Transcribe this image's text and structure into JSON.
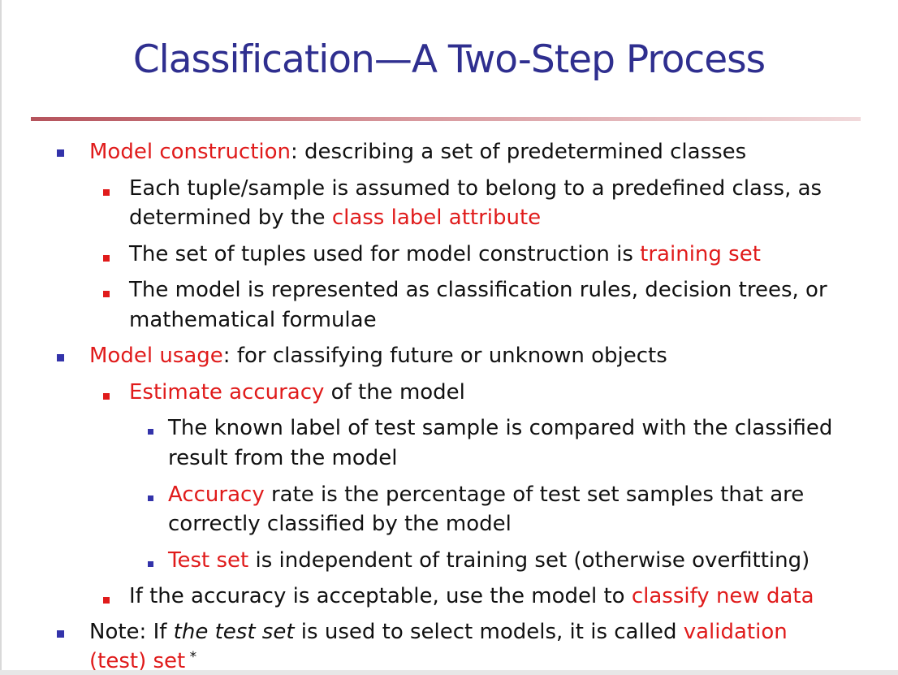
{
  "title": "Classification—A Two-Step Process",
  "colors": {
    "title": "#2f2f8f",
    "highlight": "#e01b1b",
    "level1_bullet": "#3333aa",
    "level2_bullet": "#e01b1b",
    "level3_bullet": "#3333aa",
    "divider": "#b5535c"
  },
  "bullets": {
    "b1": {
      "term": "Model construction",
      "rest": ": describing a set of predetermined classes"
    },
    "b1_1": {
      "l1": "Each tuple/sample is assumed to belong to a predefined class, as",
      "l2_pre": "determined by the ",
      "l2_term": "class label attribute"
    },
    "b1_2": {
      "pre": "The set of tuples used for model construction is ",
      "term": "training set"
    },
    "b1_3": {
      "l1": "The model is represented as classification rules, decision trees, or",
      "l2": "mathematical formulae"
    },
    "b2": {
      "term": "Model usage",
      "rest": ": for classifying future or unknown objects"
    },
    "b2_1": {
      "term": "Estimate accuracy",
      "rest": " of the model"
    },
    "b2_1_1": {
      "l1": "The known label of test sample is compared with the classified",
      "l2": "result from the model"
    },
    "b2_1_2": {
      "term": "Accuracy",
      "l1_rest": " rate is the percentage of test set samples that are",
      "l2": "correctly classified by the model"
    },
    "b2_1_3": {
      "term": "Test set",
      "rest": " is independent of training set (otherwise overfitting)"
    },
    "b2_2": {
      "pre": "If the accuracy is acceptable, use the model to ",
      "term": "classify new data"
    },
    "b3": {
      "pre": "Note: If ",
      "ital": "the test set",
      "mid": " is used to select models, it is called ",
      "term1": "validation",
      "term2": "(test) set",
      "mark": " *"
    }
  }
}
